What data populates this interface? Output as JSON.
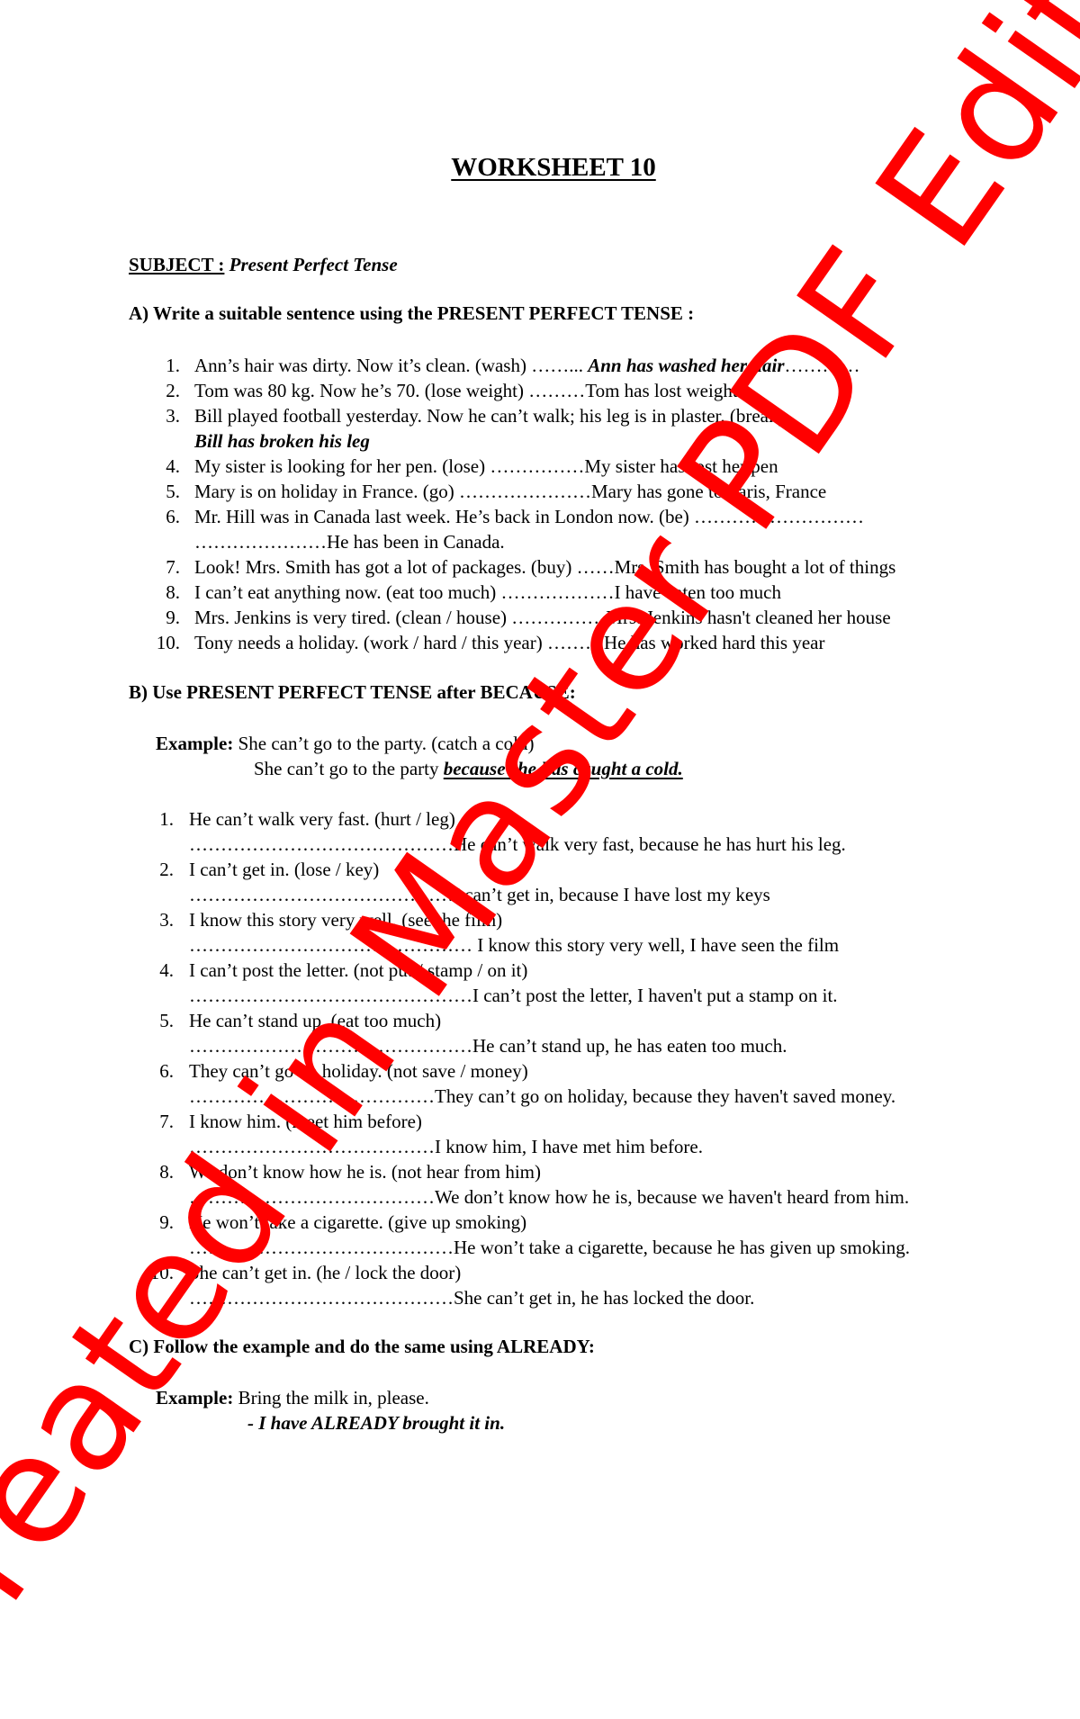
{
  "title": "WORKSHEET 10",
  "subject": {
    "label": "SUBJECT :",
    "value": "Present Perfect Tense"
  },
  "sectionA": {
    "heading": "A) Write a suitable sentence using the PRESENT PERFECT TENSE :",
    "items": [
      {
        "num": "1.",
        "question": "Ann’s hair was dirty. Now it’s clean. (wash) ……... ",
        "answer": "Ann has washed her hair",
        "answer_style": "bold-italic",
        "trail": "…………"
      },
      {
        "num": "2.",
        "question": "Tom was 80 kg. Now he’s 70. (lose weight) ………",
        "answer": "Tom has lost weight"
      },
      {
        "num": "3.",
        "question": "Bill played football yesterday. Now he can’t walk; his leg is in plaster. (break)",
        "answer": "Bill has broken his leg",
        "answer_style": "bold-italic",
        "answer_newline": true
      },
      {
        "num": "4.",
        "question": "My sister is looking for her pen. (lose) ……………",
        "answer": "My sister has lost her pen"
      },
      {
        "num": "5.",
        "question": "Mary is on holiday in France. (go) …………………",
        "answer": "Mary has gone to Paris, France"
      },
      {
        "num": "6.",
        "question": "Mr. Hill was in Canada last week. He’s back in London now. (be) ………………………",
        "answer": "…………………He has been in Canada.",
        "answer_newline": true
      },
      {
        "num": "7.",
        "question": "Look! Mrs. Smith has got a lot of packages. (buy) ……",
        "answer": "Mrs. Smith has bought a lot of things"
      },
      {
        "num": "8.",
        "question": "I can’t eat anything now. (eat too much) ………………",
        "answer": "I have eaten too much"
      },
      {
        "num": "9.",
        "question": "Mrs. Jenkins is very tired. (clean / house) ……………",
        "answer": "Mrs. Jenkins hasn't cleaned her house"
      },
      {
        "num": "10.",
        "question": "Tony needs a holiday. (work / hard / this year) ………",
        "answer": "He has worked hard this year"
      }
    ]
  },
  "sectionB": {
    "heading": "B) Use PRESENT PERFECT TENSE after BECAUSE:",
    "example": {
      "label": "Example:",
      "question": "She can’t go to the party. (catch a cold)",
      "answer_prefix": "She can’t go to the party ",
      "answer": "because she has caught a cold."
    },
    "items": [
      {
        "num": "1.",
        "question": "He can’t walk very fast. (hurt / leg)",
        "dots": "……………………………………",
        "answer": "He can’t walk very fast, because he has hurt his leg."
      },
      {
        "num": "2.",
        "question": "I can’t get in. (lose / key)",
        "dots": "……………………………………",
        "answer": "I can’t get in, because I have lost my keys"
      },
      {
        "num": "3.",
        "question": "I know this story very well. (see the film)",
        "dots": "……………………………………… ",
        "answer": "I know this story very well, I have seen the film"
      },
      {
        "num": "4.",
        "question": "I can’t post the letter. (not put / stamp / on it)",
        "dots": "………………………………………",
        "answer": "I can’t post the letter, I haven't put a stamp on it."
      },
      {
        "num": "5.",
        "question": "He can’t stand up. (eat too much)",
        "dots": "………………………………………",
        "answer": "He can’t stand up, he has eaten too much."
      },
      {
        "num": "6.",
        "question": "They can’t go on holiday. (not save / money)",
        "dots": "…………………………………",
        "answer": "They can’t go on holiday, because they haven't saved money."
      },
      {
        "num": "7.",
        "question": "I know him. (meet him before)",
        "dots": "…………………………………",
        "answer": "I know him, I have met him before."
      },
      {
        "num": "8.",
        "question": "We don’t know how he is. (not hear from him)",
        "dots": "…………………………………",
        "answer": "We don’t know how he is, because we haven't heard from him."
      },
      {
        "num": "9.",
        "question": "He won’t take a cigarette. (give up smoking)",
        "dots": "……………………………………",
        "answer": "He won’t take a cigarette, because he has given up smoking."
      },
      {
        "num": "10.",
        "question": "She can’t get in. (he / lock the door)",
        "dots": "……………………………………",
        "answer": "She can’t get in, he has locked the door."
      }
    ]
  },
  "sectionC": {
    "heading": "C) Follow the example and do the same using ALREADY:",
    "example": {
      "label": "Example:",
      "question": "Bring the milk in, please.",
      "answer": "- I have ALREADY brought it in."
    }
  },
  "watermark": {
    "text": "Created in Master PDF Editor",
    "color": "#ff0000"
  }
}
